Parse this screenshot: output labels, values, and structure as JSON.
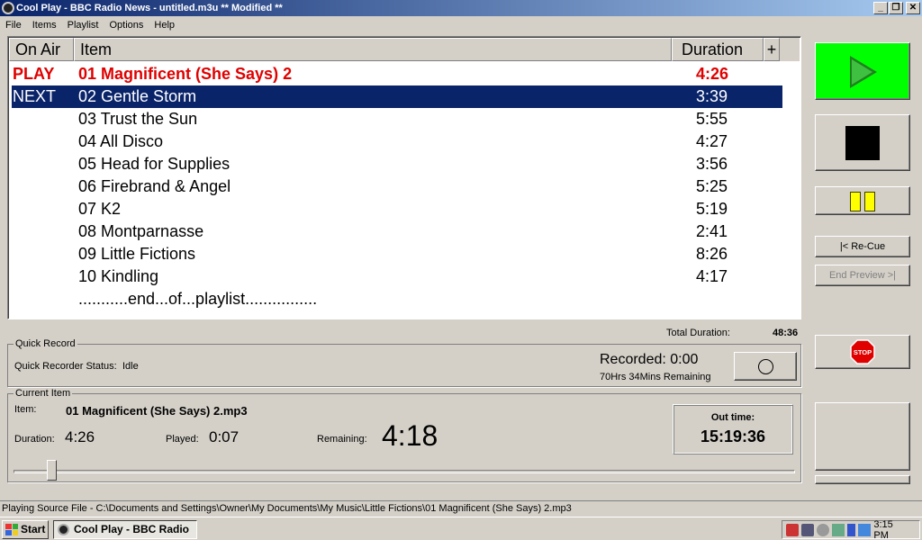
{
  "window": {
    "title": "Cool Play - BBC Radio News - untitled.m3u ** Modified **"
  },
  "menu": [
    "File",
    "Items",
    "Playlist",
    "Options",
    "Help"
  ],
  "playlist": {
    "headers": {
      "on_air": "On Air",
      "item": "Item",
      "duration": "Duration",
      "add": "+"
    },
    "rows": [
      {
        "on_air": "PLAY",
        "item": "01 Magnificent (She Says) 2",
        "duration": "4:26"
      },
      {
        "on_air": "NEXT",
        "item": "02 Gentle Storm",
        "duration": "3:39"
      },
      {
        "on_air": "",
        "item": "03 Trust the Sun",
        "duration": "5:55"
      },
      {
        "on_air": "",
        "item": "04 All Disco",
        "duration": "4:27"
      },
      {
        "on_air": "",
        "item": "05 Head for Supplies",
        "duration": "3:56"
      },
      {
        "on_air": "",
        "item": "06 Firebrand & Angel",
        "duration": "5:25"
      },
      {
        "on_air": "",
        "item": "07 K2",
        "duration": "5:19"
      },
      {
        "on_air": "",
        "item": "08 Montparnasse",
        "duration": "2:41"
      },
      {
        "on_air": "",
        "item": "09 Little Fictions",
        "duration": "8:26"
      },
      {
        "on_air": "",
        "item": "10 Kindling",
        "duration": "4:17"
      },
      {
        "on_air": "",
        "item": "...........end...of...playlist................",
        "duration": ""
      }
    ],
    "total_label": "Total Duration:",
    "total_value": "48:36"
  },
  "controls": {
    "recue_label": "|< Re-Cue",
    "end_preview_label": "End Preview >|",
    "stop_sign_text": "STOP",
    "play_color": "#00ff00",
    "pause_color": "#ffff00"
  },
  "quick_record": {
    "legend": "Quick Record",
    "status_label": "Quick Recorder Status:",
    "status_value": "Idle",
    "recorded": "Recorded: 0:00",
    "remaining": "70Hrs 34Mins Remaining"
  },
  "current_item": {
    "legend": "Current Item",
    "item_label": "Item:",
    "item_value": "01 Magnificent (She Says) 2.mp3",
    "duration_label": "Duration:",
    "duration_value": "4:26",
    "played_label": "Played:",
    "played_value": "0:07",
    "remaining_label": "Remaining:",
    "remaining_value": "4:18",
    "out_time_label": "Out time:",
    "out_time_value": "15:19:36",
    "progress": 0.027
  },
  "status_bar": "Playing Source File - C:\\Documents and Settings\\Owner\\My Documents\\My Music\\Little Fictions\\01 Magnificent (She Says) 2.mp3",
  "taskbar": {
    "start_label": "Start",
    "task_label": "Cool Play - BBC Radio ...",
    "clock": "3:15 PM"
  }
}
